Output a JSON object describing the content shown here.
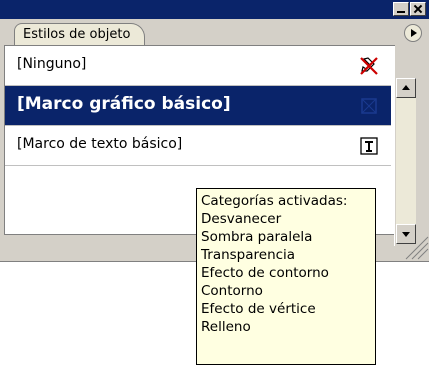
{
  "panel": {
    "tab_label": "Estilos de objeto",
    "rows": [
      {
        "label": "[Ninguno]",
        "icon": "no-style-icon"
      },
      {
        "label": "[Marco gráfico básico]",
        "icon": "graphic-frame-icon",
        "selected": true
      },
      {
        "label": "[Marco de texto básico]",
        "icon": "text-frame-icon"
      }
    ]
  },
  "tooltip": {
    "heading": "Categorías activadas:",
    "items": [
      "Desvanecer",
      "Sombra paralela",
      "Transparencia",
      "Efecto de contorno",
      "Contorno",
      "Efecto de vértice",
      "Relleno"
    ]
  },
  "colors": {
    "title_bar": "#0a246a",
    "selection": "#0a246a",
    "panel_bg": "#d4d0c8",
    "tooltip_bg": "#ffffe1",
    "no_style_icon_red": "#cc0000"
  }
}
